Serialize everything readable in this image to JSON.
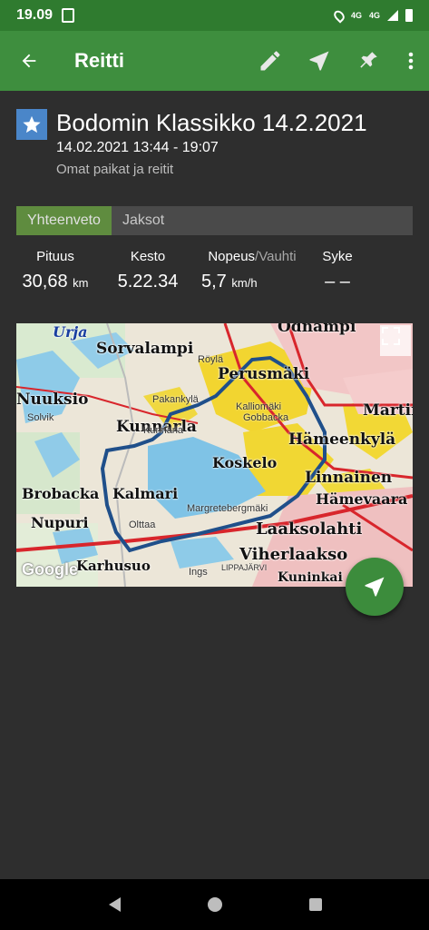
{
  "status": {
    "time": "19.09",
    "network": "4G",
    "network2": "4G"
  },
  "app_bar": {
    "title": "Reitti",
    "icons": [
      "back-arrow-icon",
      "pencil-icon",
      "navigate-icon",
      "pin-icon",
      "more-vert-icon"
    ]
  },
  "route": {
    "title": "Bodomin Klassikko 14.2.2021",
    "time_range": "14.02.2021 13:44 - 19:07",
    "category": "Omat paikat ja reitit",
    "star_color": "#4a86c9"
  },
  "tabs": [
    {
      "label": "Yhteenveto",
      "active": true
    },
    {
      "label": "Jaksot",
      "active": false
    }
  ],
  "stats": {
    "length": {
      "label": "Pituus",
      "value": "30,68",
      "unit": "km"
    },
    "duration": {
      "label": "Kesto",
      "value": "5.22.34"
    },
    "speed": {
      "label": "Nopeus",
      "label_sep": "/Vauhti",
      "value": "5,7",
      "unit": "km/h"
    },
    "heart": {
      "label": "Syke",
      "value": "– –"
    }
  },
  "map": {
    "labels_large": [
      "Urja",
      "Odnämpi",
      "Sorvalampi",
      "Perusmäki",
      "Nuuksio",
      "Kunnarla",
      "Martin",
      "Hämeenkylä",
      "Koskelo",
      "Linnainen",
      "Brobacka",
      "Kalmari",
      "Hämevaara",
      "Nupuri",
      "Laaksolahti",
      "Viherlaakso",
      "Karhusuo",
      "Kuninkai"
    ],
    "labels_small": [
      "Röylä",
      "Pakankylä",
      "Kalliomäki",
      "Gobbacka",
      "Solvik",
      "Kunnarla",
      "Margretebergmäki",
      "Olttaa",
      "LIPPAJÄRVI",
      "Ings"
    ],
    "attribution": "Google",
    "route_color": "#1f4f8a",
    "accent": "#3e8e3e"
  },
  "nav": {
    "icons": [
      "back-triangle-icon",
      "home-circle-icon",
      "recents-square-icon"
    ]
  }
}
